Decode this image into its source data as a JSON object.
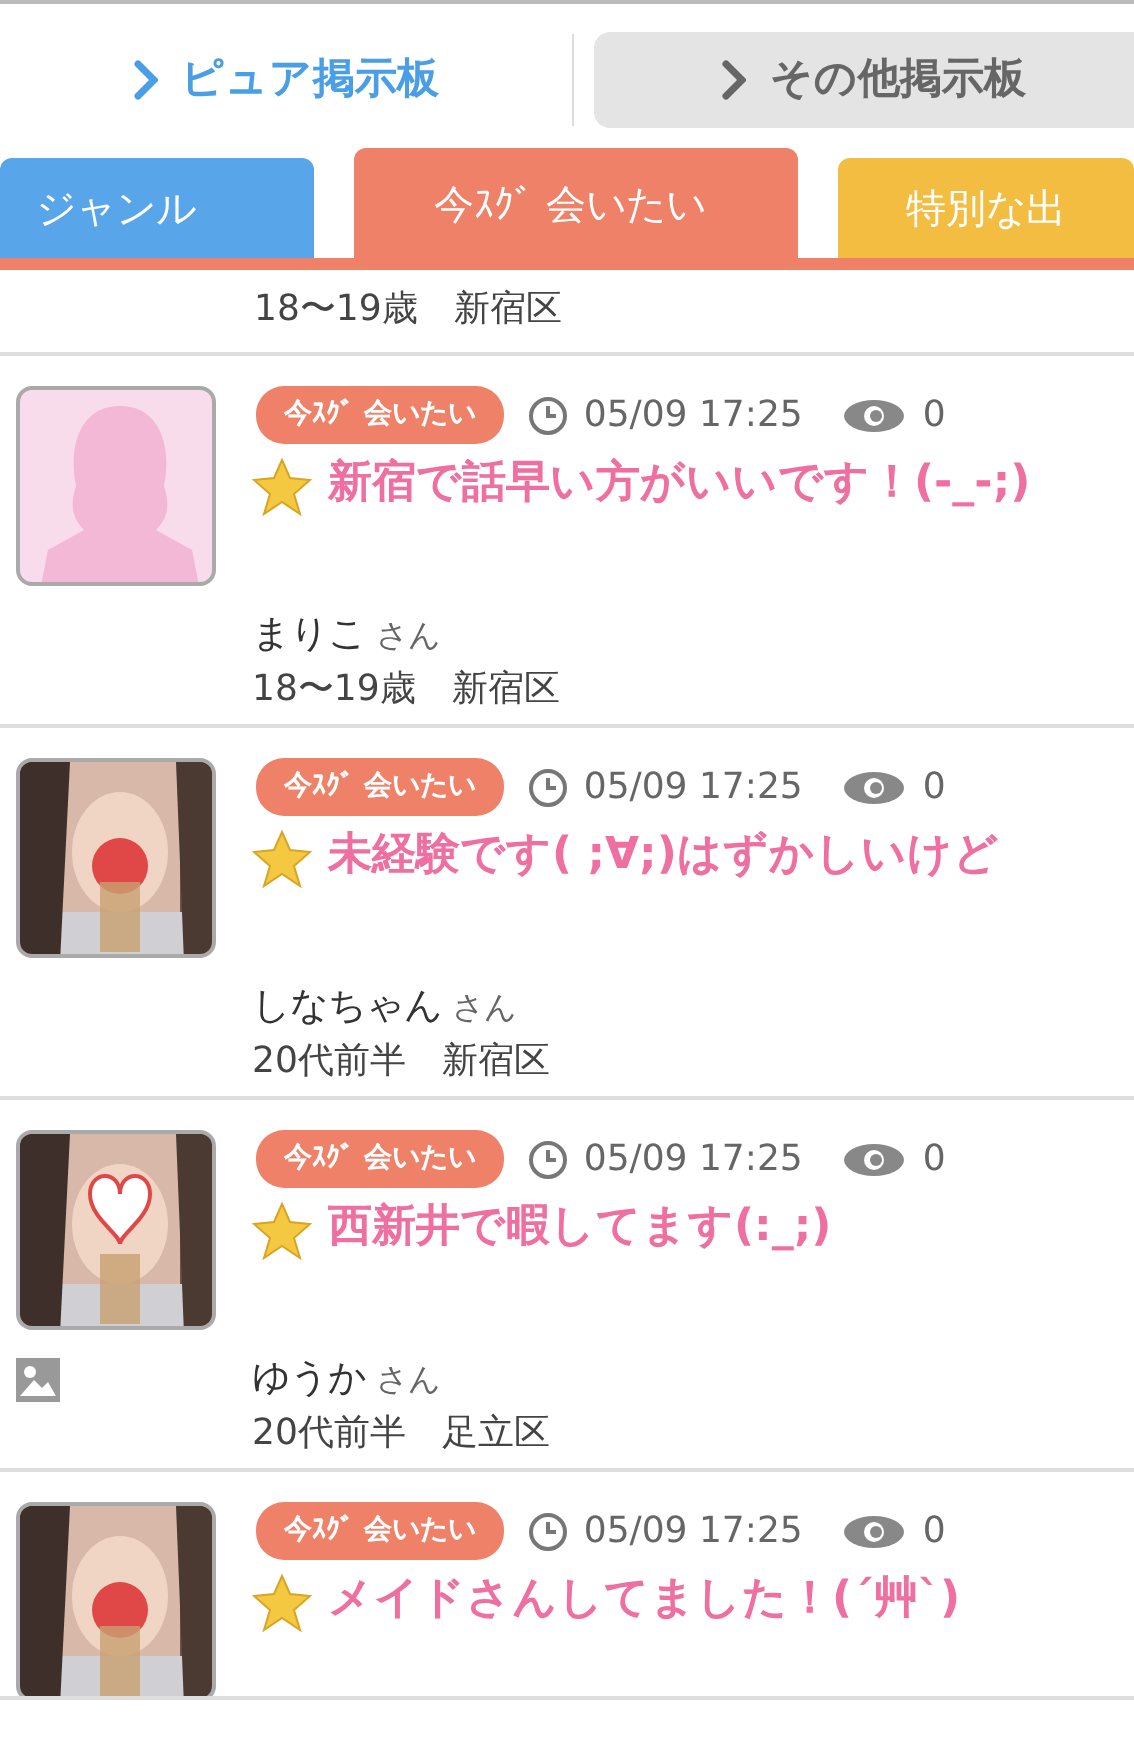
{
  "board_tabs": [
    {
      "label": "ピュア掲示板",
      "selected": true
    },
    {
      "label": "その他掲示板",
      "selected": false
    }
  ],
  "genre_tabs": [
    {
      "label": "ジャンル",
      "color": "#58a5ea",
      "selected": false
    },
    {
      "label": "今ｽｸﾞ 会いたい",
      "color": "#ee8168",
      "selected": true
    },
    {
      "label": "特別な出",
      "color": "#f3bd41",
      "selected": false
    }
  ],
  "partial_post": {
    "profile": "18〜19歳　新宿区"
  },
  "posts": [
    {
      "kind": "silhouette",
      "photo_attached": false,
      "badge": "今ｽｸﾞ 会いたい",
      "time": "05/09 17:25",
      "views": "0",
      "title": "新宿で話早い方がいいです！(-_-;)",
      "name": "まりこ",
      "honorific": "さん",
      "profile": "18〜19歳　新宿区"
    },
    {
      "photo_attached": false,
      "badge": "今ｽｸﾞ 会いたい",
      "time": "05/09 17:25",
      "views": "0",
      "title": "未経験です( ;∀;)はずかしいけど",
      "name": "しなちゃん",
      "honorific": "さん",
      "profile": "20代前半　新宿区"
    },
    {
      "photo_attached": true,
      "badge": "今ｽｸﾞ 会いたい",
      "time": "05/09 17:25",
      "views": "0",
      "title": "西新井で暇してます(:_;)",
      "name": "ゆうか",
      "honorific": "さん",
      "profile": "20代前半　足立区"
    },
    {
      "photo_attached": false,
      "badge": "今ｽｸﾞ 会いたい",
      "time": "05/09 17:25",
      "views": "0",
      "title": "メイドさんしてました！(´艸`)"
    }
  ]
}
